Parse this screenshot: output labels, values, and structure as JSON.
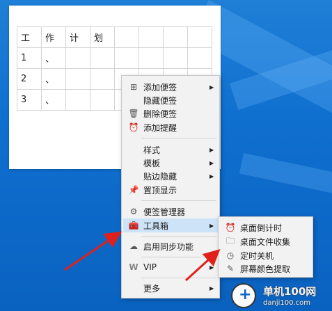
{
  "note": {
    "rows": [
      [
        "工",
        "作",
        "计",
        "划",
        "",
        "",
        "",
        ""
      ],
      [
        "1",
        "、",
        "",
        "",
        "",
        "",
        "",
        ""
      ],
      [
        "2",
        "、",
        "",
        "",
        "",
        "",
        "",
        ""
      ],
      [
        "3",
        "、",
        "",
        "",
        "",
        "",
        "",
        ""
      ]
    ]
  },
  "menu": {
    "add_note": "添加便签",
    "hide_note": "隐藏便签",
    "delete_note": "删除便签",
    "add_reminder": "添加提醒",
    "style": "样式",
    "template": "模板",
    "edge_hide": "贴边隐藏",
    "pin_top": "置顶显示",
    "note_manager": "便签管理器",
    "toolbox": "工具箱",
    "enable_sync": "启用同步功能",
    "vip": "VIP",
    "more": "更多"
  },
  "submenu": {
    "countdown": "桌面倒计时",
    "file_collect": "桌面文件收集",
    "timed_shutdown": "定时关机",
    "color_picker": "屏幕颜色提取"
  },
  "watermark": {
    "name": "单机100网",
    "url": "danji100.com"
  },
  "colors": {
    "desktop": "#0f6fcf",
    "menu_bg": "#f2f2f2",
    "highlight": "#cde3f7",
    "arrow": "#e0201b"
  }
}
